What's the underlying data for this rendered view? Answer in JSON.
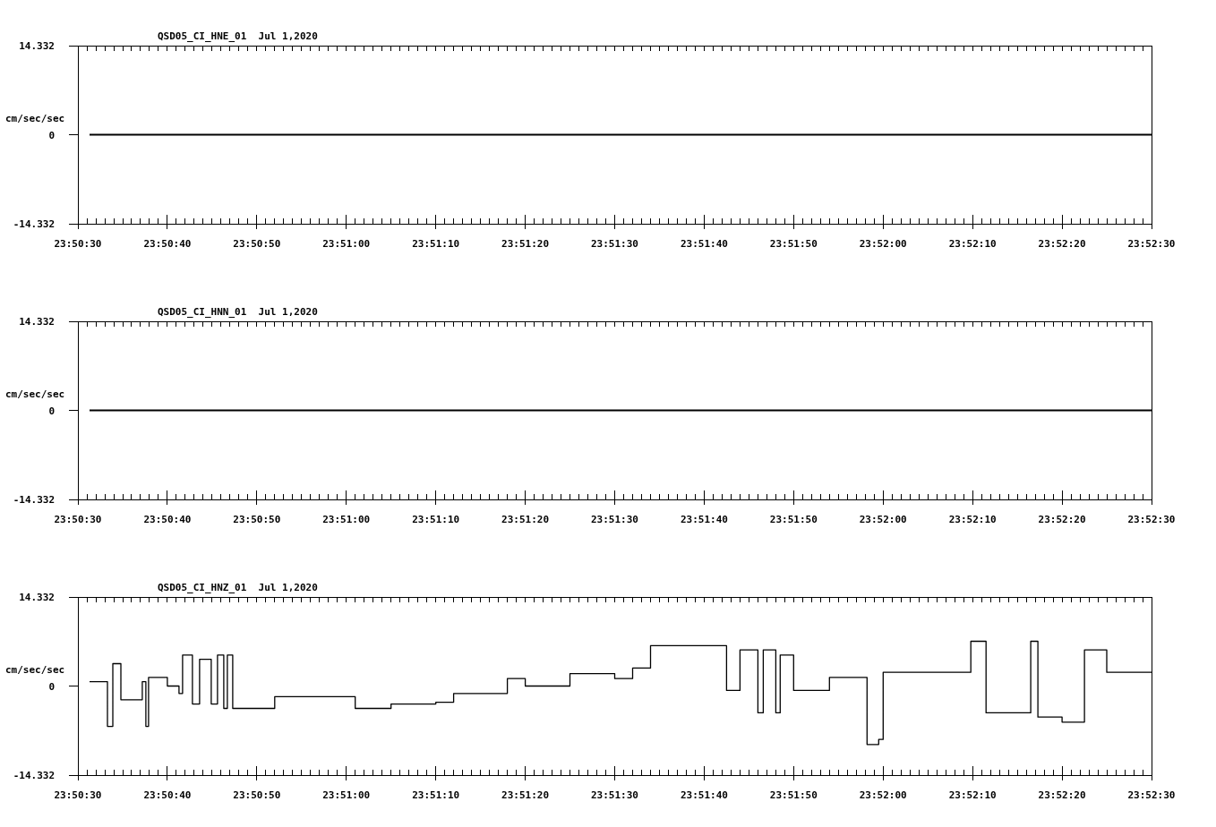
{
  "panels": [
    {
      "chart_data": {
        "type": "line",
        "title": "QSD05_CI_HNE_01  Jul 1,2020",
        "ylabel": "cm/sec/sec",
        "xlim": [
          85830,
          85950
        ],
        "ylim": [
          -14.332,
          14.332
        ],
        "yticks": [
          {
            "value": 14.332,
            "label": "14.332"
          },
          {
            "value": 0,
            "label": "0"
          },
          {
            "value": -14.332,
            "label": "-14.332"
          }
        ],
        "xticks": [
          {
            "value": 85830,
            "label": "23:50:30"
          },
          {
            "value": 85840,
            "label": "23:50:40"
          },
          {
            "value": 85850,
            "label": "23:50:50"
          },
          {
            "value": 85860,
            "label": "23:51:00"
          },
          {
            "value": 85870,
            "label": "23:51:10"
          },
          {
            "value": 85880,
            "label": "23:51:20"
          },
          {
            "value": 85890,
            "label": "23:51:30"
          },
          {
            "value": 85900,
            "label": "23:51:40"
          },
          {
            "value": 85910,
            "label": "23:51:50"
          },
          {
            "value": 85920,
            "label": "23:52:00"
          },
          {
            "value": 85930,
            "label": "23:52:10"
          },
          {
            "value": 85940,
            "label": "23:52:20"
          },
          {
            "value": 85950,
            "label": "23:52:30"
          }
        ],
        "x": [
          85831.3,
          85950
        ],
        "series": [
          {
            "color": "#000000",
            "values": [
              0,
              0
            ]
          }
        ]
      }
    },
    {
      "chart_data": {
        "type": "line",
        "title": "QSD05_CI_HNN_01  Jul 1,2020",
        "ylabel": "cm/sec/sec",
        "xlim": [
          85830,
          85950
        ],
        "ylim": [
          -14.332,
          14.332
        ],
        "yticks": [
          {
            "value": 14.332,
            "label": "14.332"
          },
          {
            "value": 0,
            "label": "0"
          },
          {
            "value": -14.332,
            "label": "-14.332"
          }
        ],
        "xticks": [
          {
            "value": 85830,
            "label": "23:50:30"
          },
          {
            "value": 85840,
            "label": "23:50:40"
          },
          {
            "value": 85850,
            "label": "23:50:50"
          },
          {
            "value": 85860,
            "label": "23:51:00"
          },
          {
            "value": 85870,
            "label": "23:51:10"
          },
          {
            "value": 85880,
            "label": "23:51:20"
          },
          {
            "value": 85890,
            "label": "23:51:30"
          },
          {
            "value": 85900,
            "label": "23:51:40"
          },
          {
            "value": 85910,
            "label": "23:51:50"
          },
          {
            "value": 85920,
            "label": "23:52:00"
          },
          {
            "value": 85930,
            "label": "23:52:10"
          },
          {
            "value": 85940,
            "label": "23:52:20"
          },
          {
            "value": 85950,
            "label": "23:52:30"
          }
        ],
        "x": [
          85831.3,
          85950
        ],
        "series": [
          {
            "color": "#000000",
            "values": [
              0,
              0
            ]
          }
        ]
      }
    },
    {
      "chart_data": {
        "type": "line",
        "title": "QSD05_CI_HNZ_01  Jul 1,2020",
        "ylabel": "cm/sec/sec",
        "xlim": [
          85830,
          85950
        ],
        "ylim": [
          -14.332,
          14.332
        ],
        "yticks": [
          {
            "value": 14.332,
            "label": "14.332"
          },
          {
            "value": 0,
            "label": "0"
          },
          {
            "value": -14.332,
            "label": "-14.332"
          }
        ],
        "xticks": [
          {
            "value": 85830,
            "label": "23:50:30"
          },
          {
            "value": 85840,
            "label": "23:50:40"
          },
          {
            "value": 85850,
            "label": "23:50:50"
          },
          {
            "value": 85860,
            "label": "23:51:00"
          },
          {
            "value": 85870,
            "label": "23:51:10"
          },
          {
            "value": 85880,
            "label": "23:51:20"
          },
          {
            "value": 85890,
            "label": "23:51:30"
          },
          {
            "value": 85900,
            "label": "23:51:40"
          },
          {
            "value": 85910,
            "label": "23:51:50"
          },
          {
            "value": 85920,
            "label": "23:52:00"
          },
          {
            "value": 85930,
            "label": "23:52:10"
          },
          {
            "value": 85940,
            "label": "23:52:20"
          },
          {
            "value": 85950,
            "label": "23:52:30"
          }
        ],
        "x": [
          85831.3,
          85833.3,
          85833.3,
          85833.9,
          85833.9,
          85834.8,
          85834.8,
          85837.2,
          85837.2,
          85837.6,
          85837.6,
          85837.9,
          85837.9,
          85840,
          85840,
          85841.3,
          85841.3,
          85841.7,
          85841.7,
          85842.8,
          85842.8,
          85843.6,
          85843.6,
          85844.9,
          85844.9,
          85845.6,
          85845.6,
          85846.3,
          85846.3,
          85846.7,
          85846.7,
          85847.3,
          85847.3,
          85852,
          85852,
          85861,
          85861,
          85865,
          85865,
          85870,
          85870,
          85872,
          85872,
          85878,
          85878,
          85880,
          85880,
          85885,
          85885,
          85890,
          85890,
          85892,
          85892,
          85894,
          85894,
          85902.5,
          85902.5,
          85904,
          85904,
          85906,
          85906,
          85906.6,
          85906.6,
          85908,
          85908,
          85908.5,
          85908.5,
          85910,
          85910,
          85914,
          85914,
          85918.2,
          85918.2,
          85919.5,
          85919.5,
          85920,
          85920,
          85929.8,
          85929.8,
          85931.5,
          85931.5,
          85936.5,
          85936.5,
          85937.3,
          85937.3,
          85940,
          85940,
          85942.5,
          85942.5,
          85945,
          85945,
          85950
        ],
        "series": [
          {
            "color": "#000000",
            "values": [
              0.7,
              0.7,
              -6.5,
              -6.5,
              3.6,
              3.6,
              -2.2,
              -2.2,
              0.7,
              0.7,
              -6.5,
              -6.5,
              1.4,
              1.4,
              0,
              0,
              -1.2,
              -1.2,
              5.0,
              5.0,
              -2.9,
              -2.9,
              4.3,
              4.3,
              -2.9,
              -2.9,
              5.0,
              5.0,
              -3.6,
              -3.6,
              5.0,
              5.0,
              -3.6,
              -3.6,
              -1.7,
              -1.7,
              -3.6,
              -3.6,
              -2.9,
              -2.9,
              -2.6,
              -2.6,
              -1.2,
              -1.2,
              1.2,
              1.2,
              0,
              0,
              2.0,
              2.0,
              1.2,
              1.2,
              2.9,
              2.9,
              6.5,
              6.5,
              -0.7,
              -0.7,
              5.8,
              5.8,
              -4.3,
              -4.3,
              5.8,
              5.8,
              -4.3,
              -4.3,
              5.0,
              5.0,
              -0.7,
              -0.7,
              1.4,
              1.4,
              -9.4,
              -9.4,
              -8.6,
              -8.6,
              2.2,
              2.2,
              7.2,
              7.2,
              -4.3,
              -4.3,
              7.2,
              7.2,
              -5.0,
              -5.0,
              -5.8,
              -5.8,
              5.8,
              5.8,
              2.2,
              2.2
            ]
          }
        ]
      }
    }
  ]
}
